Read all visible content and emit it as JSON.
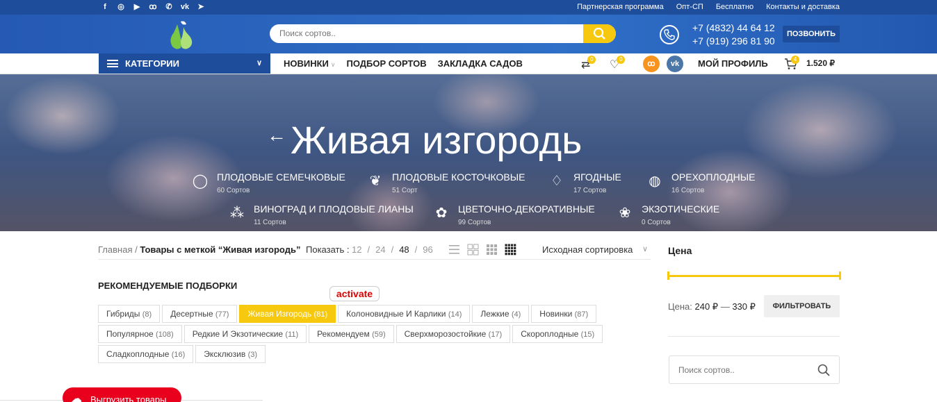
{
  "topbar": {
    "social": [
      "f",
      "ig",
      "yt",
      "ok",
      "wa",
      "vk",
      "tg"
    ],
    "links": [
      "Партнерская программа",
      "Опт-СП",
      "Бесплатно",
      "Контакты и доставка"
    ]
  },
  "header": {
    "search_placeholder": "Поиск сортов..",
    "phone1": "+7 (4832) 44 64 12",
    "phone2": "+7 (919) 296 81 90",
    "call_label": "ПОЗВОНИТЬ"
  },
  "nav": {
    "categories_label": "КАТЕГОРИИ",
    "links": [
      "НОВИНКИ",
      "ПОДБОР СОРТОВ",
      "ЗАКЛАДКА САДОВ"
    ],
    "compare_count": "0",
    "wishlist_count": "0",
    "profile_label": "МОЙ ПРОФИЛЬ",
    "cart_count": "4",
    "cart_total": "1.520 ₽"
  },
  "hero": {
    "title": "Живая изгородь",
    "categories": [
      {
        "name": "ПЛОДОВЫЕ СЕМЕЧКОВЫЕ",
        "count": "60 Сортов",
        "icon": "apple-icon"
      },
      {
        "name": "ПЛОДОВЫЕ КОСТОЧКОВЫЕ",
        "count": "51 Сорт",
        "icon": "cherry-icon"
      },
      {
        "name": "ЯГОДНЫЕ",
        "count": "17 Сортов",
        "icon": "strawberry-icon"
      },
      {
        "name": "ОРЕХОПЛОДНЫЕ",
        "count": "16 Сортов",
        "icon": "nut-icon"
      },
      {
        "name": "ВИНОГРАД И ПЛОДОВЫЕ ЛИАНЫ",
        "count": "11 Сортов",
        "icon": "grape-icon"
      },
      {
        "name": "ЦВЕТОЧНО-ДЕКОРАТИВНЫЕ",
        "count": "99 Сортов",
        "icon": "flower-icon"
      },
      {
        "name": "ЭКЗОТИЧЕСКИЕ",
        "count": "0 Сортов",
        "icon": "potted-plant-icon"
      }
    ]
  },
  "toolbar": {
    "breadcrumb_home": "Главная",
    "breadcrumb_sep": " / ",
    "breadcrumb_current": "Товары с меткой “Живая изгородь”",
    "show_label": "Показать :",
    "per_page": [
      "12",
      "24",
      "48",
      "96"
    ],
    "per_page_active": "48",
    "sort_label": "Исходная сортировка"
  },
  "recommended": {
    "title": "РЕКОМЕНДУЕМЫЕ ПОДБОРКИ",
    "activate_label": "activate",
    "rows": [
      [
        {
          "label": "Гибриды",
          "count": "(8)"
        },
        {
          "label": "Десертные",
          "count": "(77)"
        },
        {
          "label": "Живая Изгородь",
          "count": "(81)",
          "active": true
        },
        {
          "label": "Колоновидные И Карлики",
          "count": "(14)"
        },
        {
          "label": "Лежкие",
          "count": "(4)"
        },
        {
          "label": "Новинки",
          "count": "(87)"
        }
      ],
      [
        {
          "label": "Популярное",
          "count": "(108)"
        },
        {
          "label": "Редкие И Экзотические",
          "count": "(11)"
        },
        {
          "label": "Рекомендуем",
          "count": "(59)"
        },
        {
          "label": "Сверхморозостойкие",
          "count": "(17)"
        },
        {
          "label": "Скороплодные",
          "count": "(15)"
        }
      ],
      [
        {
          "label": "Сладкоплодные",
          "count": "(16)"
        },
        {
          "label": "Эксклюзив",
          "count": "(3)"
        }
      ]
    ]
  },
  "upload": {
    "label": "Выгрузить товары"
  },
  "sidebar": {
    "price_title": "Цена",
    "price_label": "Цена:",
    "price_min": "240 ₽",
    "price_sep": " — ",
    "price_max": "330 ₽",
    "filter_label": "ФИЛЬТРОВАТЬ",
    "search_placeholder": "Поиск сортов.."
  },
  "colors": {
    "brand_blue": "#1e4d9b",
    "accent_yellow": "#f6c90e",
    "red": "#e8001c"
  }
}
